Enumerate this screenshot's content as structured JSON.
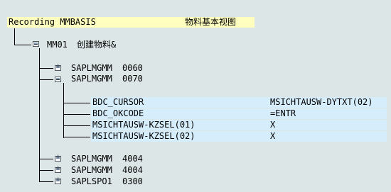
{
  "recording": {
    "label": "Recording MMBASIS",
    "description": "物料基本视图"
  },
  "transaction": {
    "code": "MM01",
    "title": "创建物料&",
    "screens": [
      {
        "program": "SAPLMGMM",
        "number": "0060",
        "state": "collapsed"
      },
      {
        "program": "SAPLMGMM",
        "number": "0070",
        "state": "expanded"
      }
    ],
    "fields": [
      {
        "name": "BDC_CURSOR",
        "value": "MSICHTAUSW-DYTXT(02)"
      },
      {
        "name": "BDC_OKCODE",
        "value": "=ENTR"
      },
      {
        "name": "MSICHTAUSW-KZSEL(01)",
        "value": "X"
      },
      {
        "name": "MSICHTAUSW-KZSEL(02)",
        "value": "X"
      }
    ],
    "screens_after": [
      {
        "program": "SAPLMGMM",
        "number": "4004",
        "state": "collapsed"
      },
      {
        "program": "SAPLMGMM",
        "number": "4004",
        "state": "collapsed"
      },
      {
        "program": "SAPLSPO1",
        "number": "0300",
        "state": "collapsed"
      }
    ]
  },
  "colors": {
    "background": "#dde6e6",
    "header_highlight": "#ffffc0",
    "field_highlight": "#d6eefc"
  },
  "icons": {
    "collapsed": "folder-plus-icon",
    "expanded": "folder-minus-icon",
    "transaction": "folder-icon"
  }
}
